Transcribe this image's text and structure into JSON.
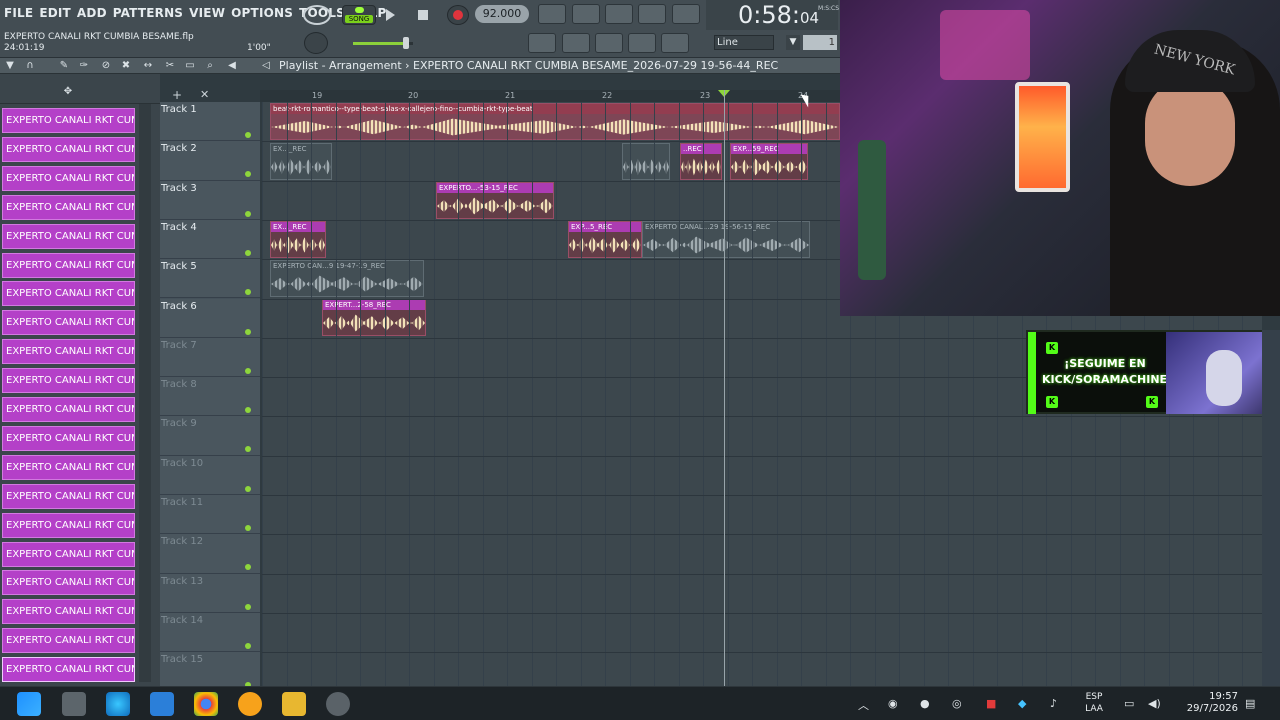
{
  "menu": [
    "FILE",
    "EDIT",
    "ADD",
    "PATTERNS",
    "VIEW",
    "OPTIONS",
    "TOOLS",
    "HELP"
  ],
  "project": {
    "filename": "EXPERTO CANALI RKT CUMBIA BESAME.flp",
    "time": "24:01:19",
    "hint_duration": "1'00\""
  },
  "transport": {
    "song_label": "SONG",
    "tempo": "92.000",
    "time_main": "0:58",
    "time_sub": "04",
    "time_units": "M:S:CS",
    "snap": "Line",
    "pattern_num": "1"
  },
  "playlist_title": "Playlist - Arrangement › EXPERTO CANALI RKT CUMBIA BESAME_2026-07-29 19-56-44_REC",
  "ruler": [
    "19",
    "20",
    "21",
    "22",
    "23",
    "24"
  ],
  "patterns": [
    "EXPERTO CANALI RKT CUM...",
    "EXPERTO CANALI RKT CUM...",
    "EXPERTO CANALI RKT CUM...",
    "EXPERTO CANALI RKT CUM...",
    "EXPERTO CANALI RKT CUM...",
    "EXPERTO CANALI RKT CUM...",
    "EXPERTO CANALI RKT CUM...",
    "EXPERTO CANALI RKT CUM...",
    "EXPERTO CANALI RKT CUM...",
    "EXPERTO CANALI RKT CUM...",
    "EXPERTO CANALI RKT CUM...",
    "EXPERTO CANALI RKT CUM...",
    "EXPERTO CANALI RKT CUM...",
    "EXPERTO CANALI RKT CUM...",
    "EXPERTO CANALI RKT CUM...",
    "EXPERTO CANALI RKT CUM...",
    "EXPERTO CANALI RKT CUM...",
    "EXPERTO CANALI RKT CUM...",
    "EXPERTO CANALI RKT CUM...",
    "EXPERTO CANALI RKT CUM..."
  ],
  "tracks": [
    "Track 1",
    "Track 2",
    "Track 3",
    "Track 4",
    "Track 5",
    "Track 6",
    "Track 7",
    "Track 8",
    "Track 9",
    "Track 10",
    "Track 11",
    "Track 12",
    "Track 13",
    "Track 14",
    "Track 15"
  ],
  "clips": {
    "t1": "beat-rkt-romantico--type-beat-salas-x-callejero-fino--cumbia-rkt-type-beat",
    "t2a": "EX..._REC",
    "t2b": "",
    "t2c": "..REC",
    "t2d": "EXP...59_REC",
    "t3": "EXPERTO...-53-15_REC",
    "t4a": "EX..._REC",
    "t4b": "EXP...5_REC",
    "t4c": "EXPERTO CANAL...29 19-56-15_REC",
    "t5": "EXPERTO CAN...9 19-47-19_REC",
    "t6": "EXPERT...2-58_REC"
  },
  "overlay": {
    "kick_text": "¡SEGUIME EN KICK/SORAMACHINE!",
    "cap_text": "NEW YORK"
  },
  "tray": {
    "lang1": "ESP",
    "lang2": "LAA",
    "time": "19:57",
    "date": "29/7/2026"
  },
  "colors": {
    "accent_green": "#8ed63c",
    "pattern_purple": "#b440c8",
    "kick_green": "#53fc18"
  }
}
